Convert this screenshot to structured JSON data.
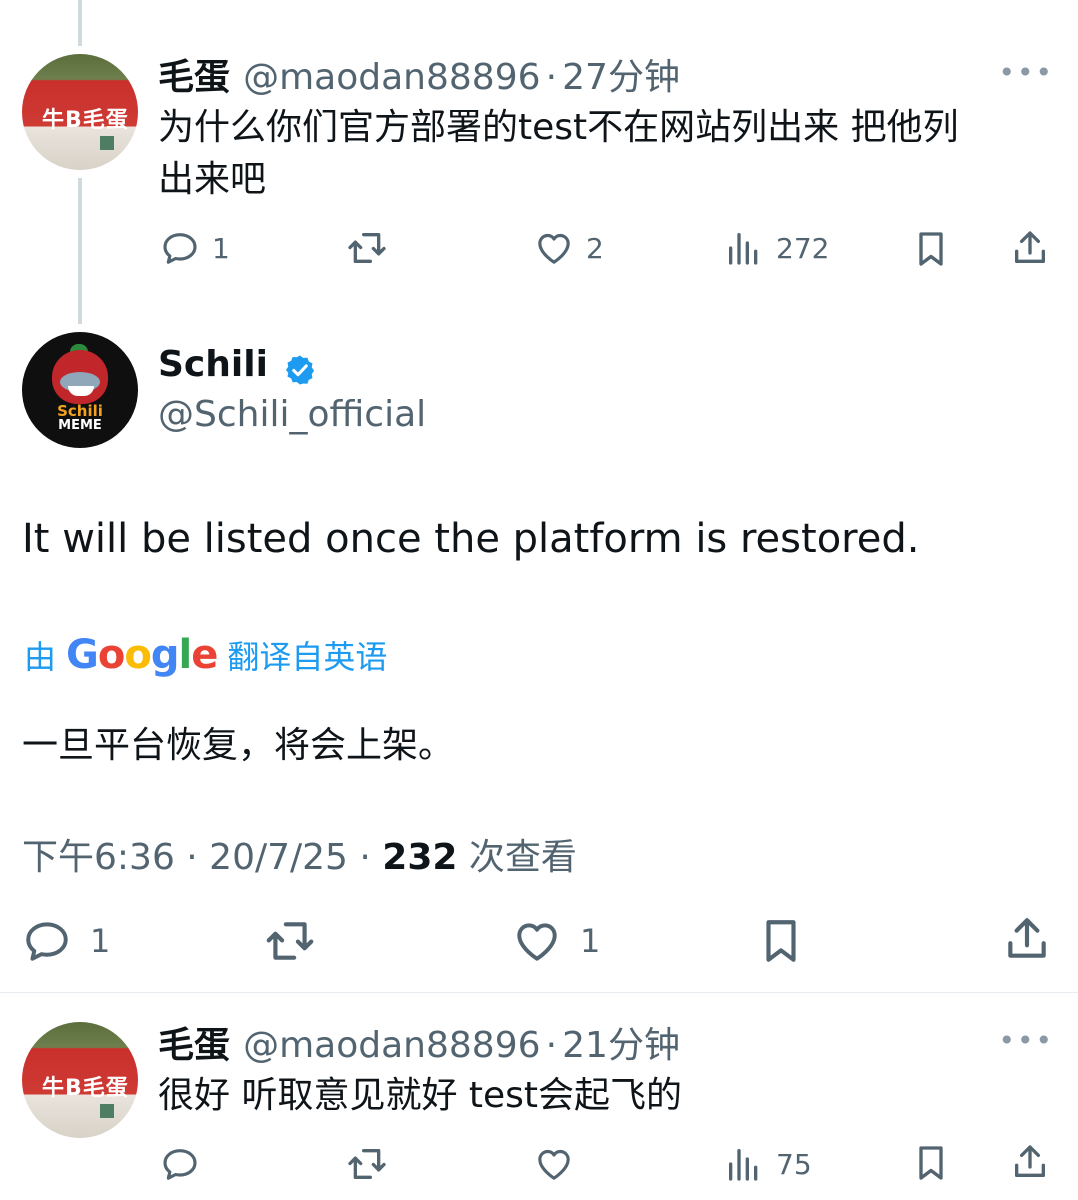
{
  "tweet1": {
    "name": "毛蛋",
    "handle": "@maodan88896",
    "dot": "·",
    "time": "27分钟",
    "text_line1": "为什么你们官方部署的test不在网站列出来 把他列",
    "text_line2": "出来吧",
    "avatar_sign": "牛B毛蛋",
    "replies": "1",
    "likes": "2",
    "views": "272"
  },
  "main_tweet": {
    "name": "Schili",
    "handle": "@Schili_official",
    "avatar_line1": "Schili",
    "avatar_line2": "MEME",
    "text": "It will be listed once the platform is restored.",
    "translate_prefix": "由",
    "translate_brand": "Google",
    "translate_suffix": "翻译自英语",
    "translated_text": "一旦平台恢复，将会上架。",
    "timestamp": "下午6:36 · 20/7/25 · ",
    "view_count": "232",
    "view_label": " 次查看",
    "replies": "1",
    "likes": "1",
    "verified_color": "#1d9bf0"
  },
  "tweet3": {
    "name": "毛蛋",
    "handle": "@maodan88896",
    "dot": "·",
    "time": "21分钟",
    "text": "很好 听取意见就好 test会起飞的",
    "avatar_sign": "牛B毛蛋",
    "views": "75"
  },
  "icons": [
    "reply-icon",
    "retweet-icon",
    "like-icon",
    "views-icon",
    "bookmark-icon",
    "share-icon",
    "more-icon",
    "verified-badge-icon"
  ],
  "colors": {
    "link_blue": "#1d9bf0",
    "meta_gray": "#536471",
    "text": "#0f1419"
  }
}
